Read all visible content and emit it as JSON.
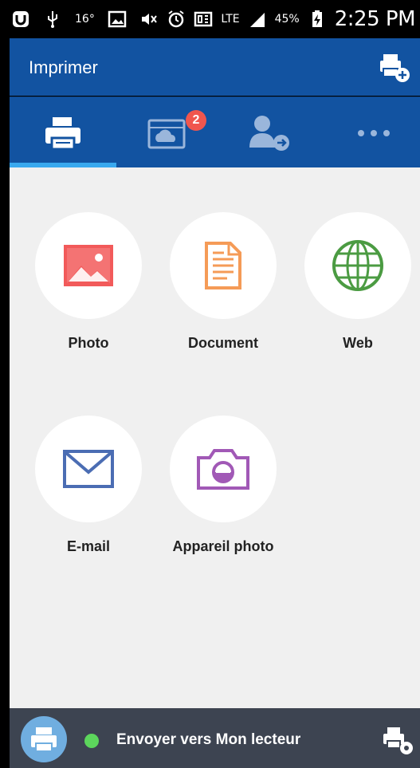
{
  "status_bar": {
    "temperature": "16°",
    "network": "LTE",
    "battery": "45%",
    "time": "2:25 PM"
  },
  "app_bar": {
    "title": "Imprimer",
    "add_printer_icon": "printer-add-icon"
  },
  "tabs": [
    {
      "id": "print",
      "icon": "printer-icon",
      "selected": true
    },
    {
      "id": "cloud",
      "icon": "cloud-gallery-icon",
      "badge": "2"
    },
    {
      "id": "contacts",
      "icon": "person-send-icon"
    },
    {
      "id": "more",
      "icon": "more-dots-icon"
    }
  ],
  "tiles": [
    {
      "label": "Photo",
      "icon": "image-icon",
      "color": "#f25a5a"
    },
    {
      "label": "Document",
      "icon": "document-icon",
      "color": "#f59b57"
    },
    {
      "label": "Web",
      "icon": "globe-icon",
      "color": "#4b9b42"
    },
    {
      "label": "E-mail",
      "icon": "envelope-icon",
      "color": "#4b6db3"
    },
    {
      "label": "Appareil photo",
      "icon": "camera-icon",
      "color": "#a159b6"
    }
  ],
  "bottom_bar": {
    "printer_label": "Envoyer vers Mon lecteur",
    "status_color": "#5cd65c",
    "settings_icon": "printer-settings-icon"
  }
}
